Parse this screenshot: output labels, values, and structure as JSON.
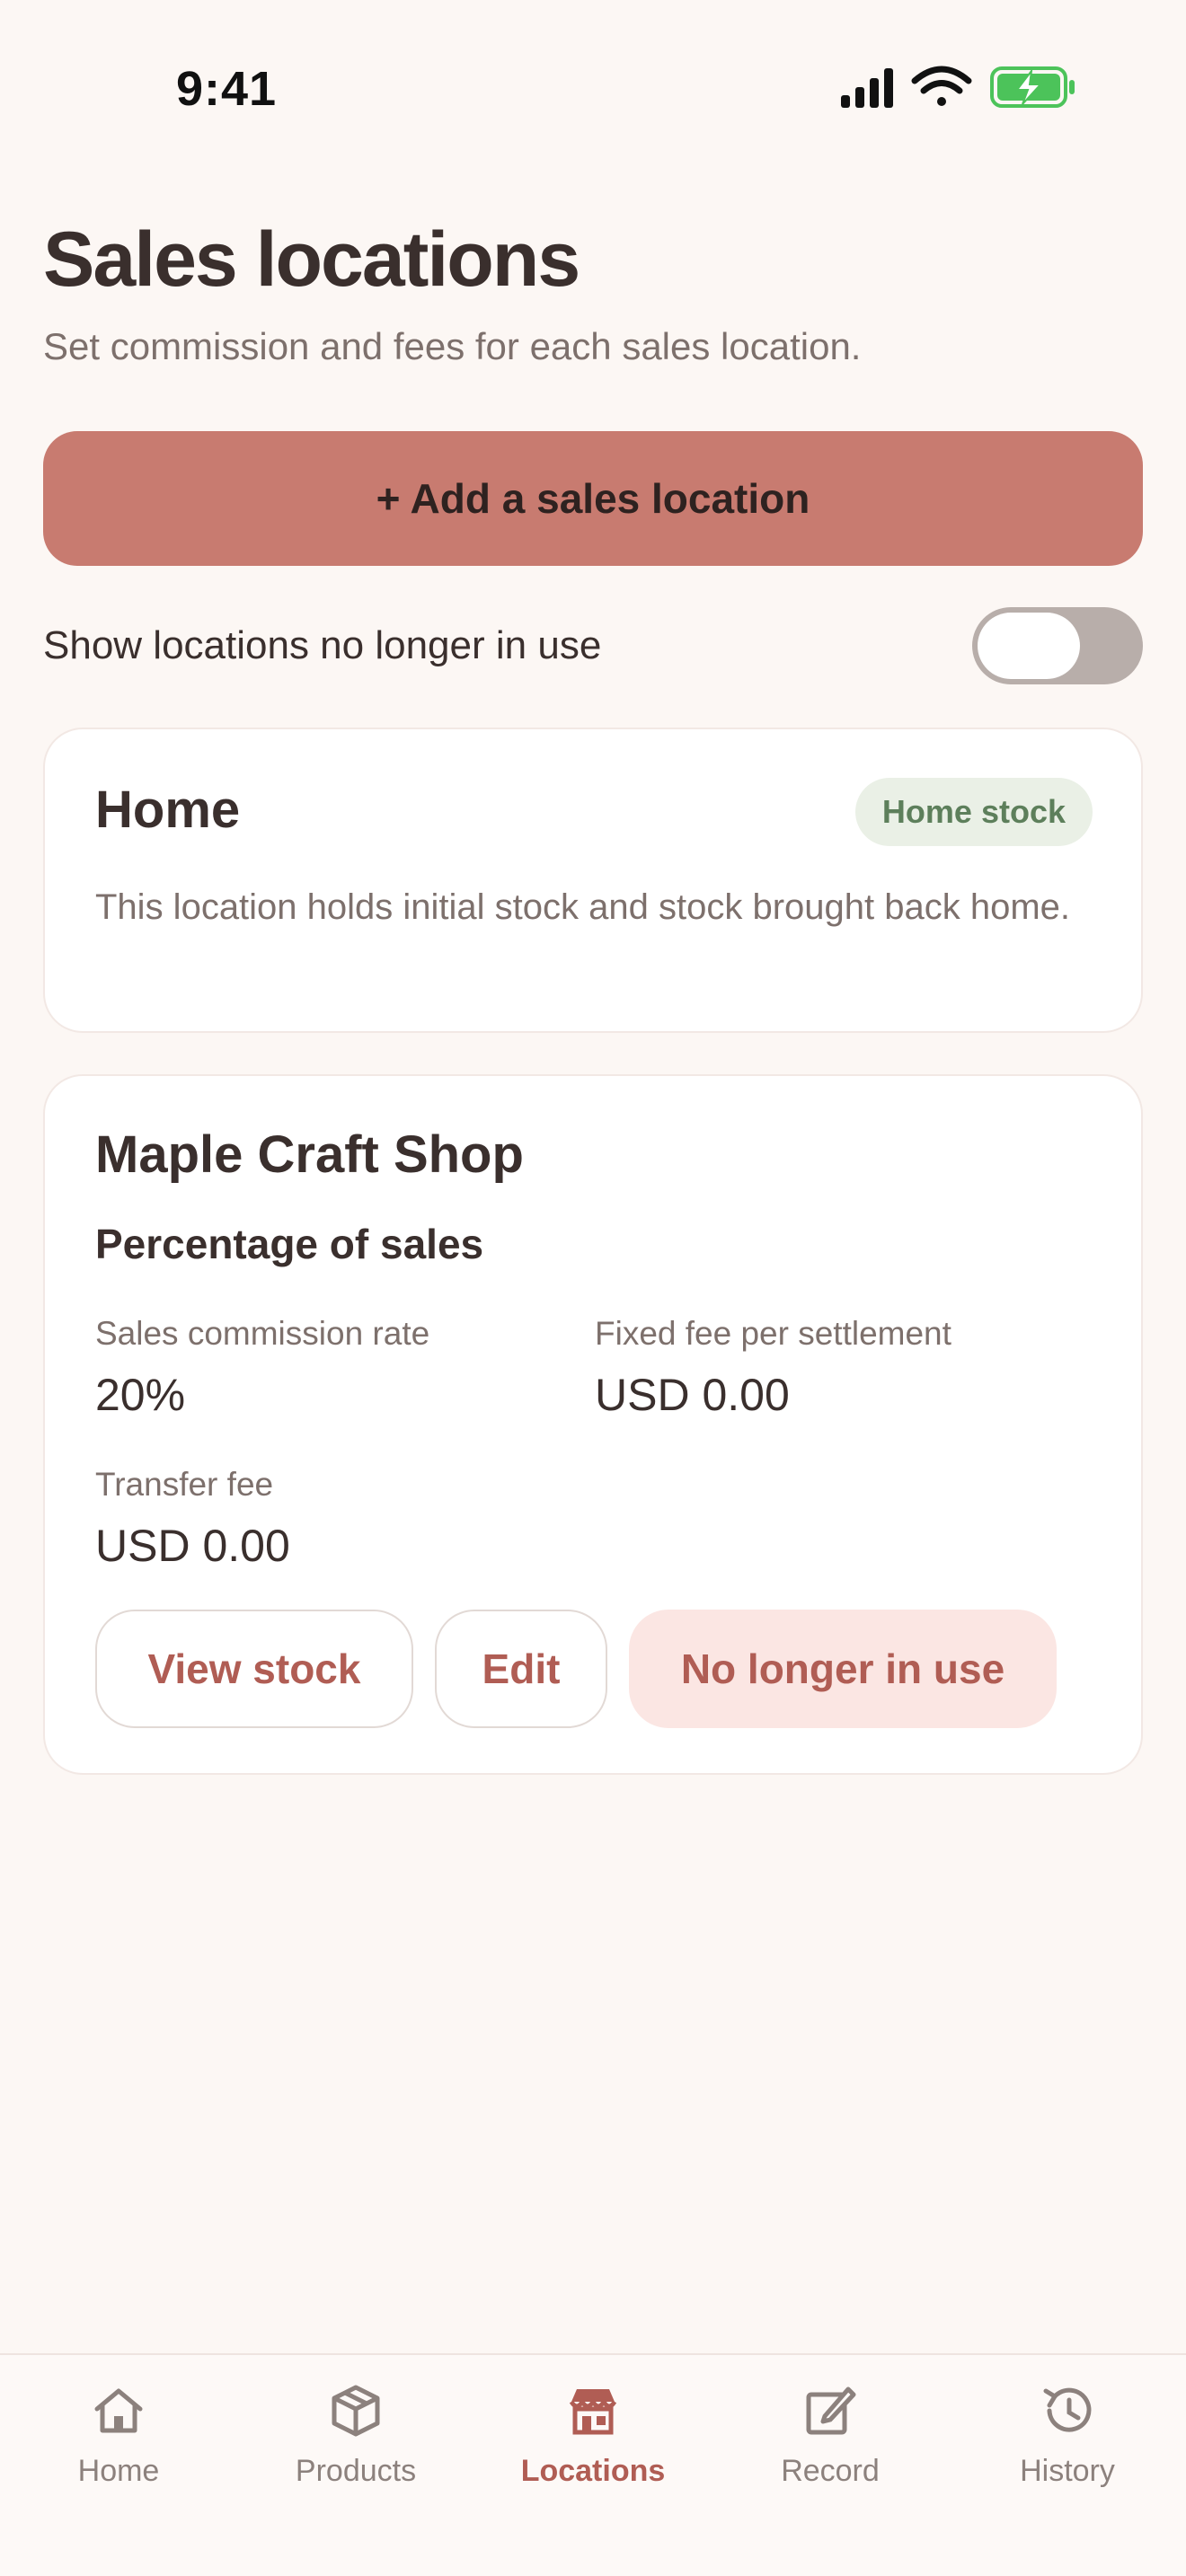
{
  "status_bar": {
    "time": "9:41"
  },
  "header": {
    "title": "Sales locations",
    "subtitle": "Set commission and fees for each sales location."
  },
  "add_button": {
    "label": "+ Add a sales location"
  },
  "toggle": {
    "label": "Show locations no longer in use",
    "on": false
  },
  "locations": [
    {
      "name": "Home",
      "badge": "Home stock",
      "description": "This location holds initial stock and stock brought back home."
    },
    {
      "name": "Maple Craft Shop",
      "type": "Percentage of sales",
      "commission_label": "Sales commission rate",
      "commission_value": "20%",
      "fixed_fee_label": "Fixed fee per settlement",
      "fixed_fee_value": "USD 0.00",
      "transfer_fee_label": "Transfer fee",
      "transfer_fee_value": "USD 0.00",
      "actions": {
        "view_stock": "View stock",
        "edit": "Edit",
        "retire": "No longer in use"
      }
    }
  ],
  "tab_bar": {
    "active": "Locations",
    "tabs": [
      {
        "label": "Home",
        "icon": "house-icon"
      },
      {
        "label": "Products",
        "icon": "box-icon"
      },
      {
        "label": "Locations",
        "icon": "store-icon"
      },
      {
        "label": "Record",
        "icon": "edit-icon"
      },
      {
        "label": "History",
        "icon": "history-icon"
      }
    ]
  },
  "colors": {
    "background": "#fcf7f4",
    "accent": "#c87b70",
    "accent_text": "#b05d54",
    "badge_bg": "#eaf0e6",
    "badge_text": "#5d7f5b",
    "battery": "#4cc35a"
  }
}
